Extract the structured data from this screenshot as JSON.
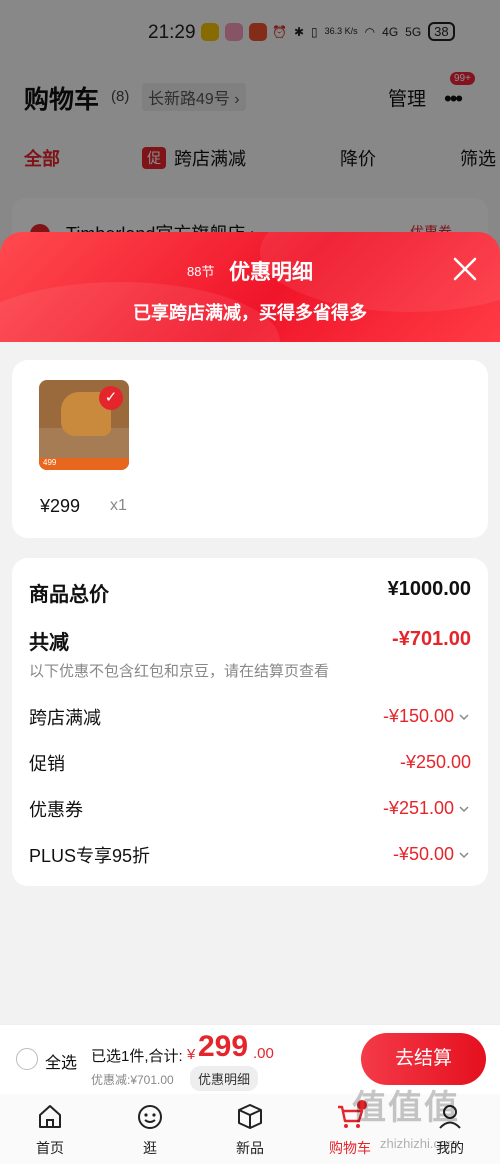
{
  "status_bar": {
    "time": "21:29",
    "net_speed": "36.3 K/s",
    "signal_1": "4G",
    "signal_2": "5G",
    "battery": "38"
  },
  "cart": {
    "title": "购物车",
    "count": "(8)",
    "address": "长新路49号 ›",
    "manage": "管理",
    "more_badge": "99+",
    "tabs": {
      "all": "全部",
      "promo_tag": "促",
      "cross_store": "跨店满减",
      "price_drop": "降价",
      "filter": "筛选"
    },
    "store_name": "Timberland官方旗舰店 ›",
    "store_coupon": "优惠券"
  },
  "sheet": {
    "tag": "88节",
    "title": "优惠明细",
    "subtitle": "已享跨店满减，买得多省得多"
  },
  "product": {
    "price": "¥299",
    "qty": "x1",
    "thumb_price": "499"
  },
  "detail": {
    "total_label": "商品总价",
    "total_value": "¥1000.00",
    "reduce_label": "共减",
    "reduce_value": "-¥701.00",
    "reduce_note": "以下优惠不包含红包和京豆，请在结算页查看",
    "rows": [
      {
        "label": "跨店满减",
        "value": "-¥150.00",
        "expandable": true
      },
      {
        "label": "促销",
        "value": "-¥250.00",
        "expandable": false
      },
      {
        "label": "优惠券",
        "value": "-¥251.00",
        "expandable": true
      },
      {
        "label": "PLUS专享95折",
        "value": "-¥50.00",
        "expandable": true
      }
    ]
  },
  "checkout": {
    "select_all": "全选",
    "selected_info": "已选1件,合计:",
    "currency": "¥",
    "total_int": "299",
    "total_dec": ".00",
    "discount_info": "优惠减:¥701.00",
    "detail_pill": "优惠明细",
    "checkout_label": "去结算"
  },
  "nav": [
    {
      "label": "首页",
      "icon": "home-icon"
    },
    {
      "label": "逛",
      "icon": "smiley-icon"
    },
    {
      "label": "新品",
      "icon": "box-icon"
    },
    {
      "label": "购物车",
      "icon": "cart-icon"
    },
    {
      "label": "我的",
      "icon": "user-icon"
    }
  ],
  "watermark": {
    "text": "值值值",
    "sub": "zhizhizhi.com"
  },
  "colors": {
    "accent": "#e5252c",
    "header_gradient_start": "#ff4a4f",
    "header_gradient_end": "#f0152a"
  }
}
